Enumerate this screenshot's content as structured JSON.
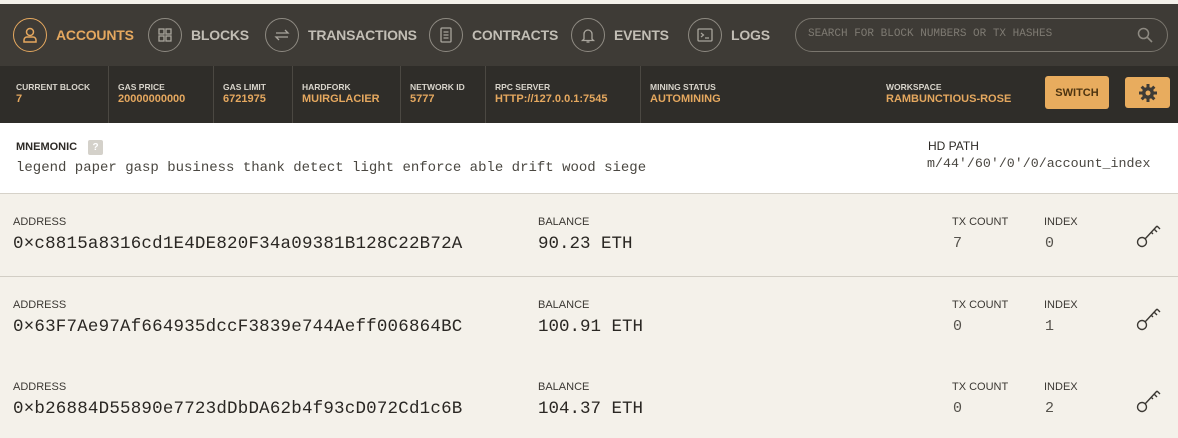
{
  "nav": {
    "items": [
      {
        "label": "ACCOUNTS",
        "icon": "person-icon",
        "active": true
      },
      {
        "label": "BLOCKS",
        "icon": "grid-icon"
      },
      {
        "label": "TRANSACTIONS",
        "icon": "transfer-arrows-icon"
      },
      {
        "label": "CONTRACTS",
        "icon": "document-icon"
      },
      {
        "label": "EVENTS",
        "icon": "bell-icon"
      },
      {
        "label": "LOGS",
        "icon": "terminal-icon"
      }
    ],
    "search_placeholder": "SEARCH FOR BLOCK NUMBERS OR TX HASHES"
  },
  "stats": {
    "current_block": {
      "label": "CURRENT BLOCK",
      "value": "7"
    },
    "gas_price": {
      "label": "GAS PRICE",
      "value": "20000000000"
    },
    "gas_limit": {
      "label": "GAS LIMIT",
      "value": "6721975"
    },
    "hardfork": {
      "label": "HARDFORK",
      "value": "MUIRGLACIER"
    },
    "network_id": {
      "label": "NETWORK ID",
      "value": "5777"
    },
    "rpc_server": {
      "label": "RPC SERVER",
      "value": "HTTP://127.0.0.1:7545"
    },
    "mining_status": {
      "label": "MINING STATUS",
      "value": "AUTOMINING"
    },
    "workspace": {
      "label": "WORKSPACE",
      "value": "RAMBUNCTIOUS-ROSE"
    },
    "switch_label": "SWITCH"
  },
  "mnemonic": {
    "label": "MNEMONIC",
    "help": "?",
    "value": "legend paper gasp business thank detect light enforce able drift wood siege",
    "hd_path_label": "HD PATH",
    "hd_path_value": "m/44'/60'/0'/0/account_index"
  },
  "columns": {
    "address": "ADDRESS",
    "balance": "BALANCE",
    "tx_count": "TX COUNT",
    "index": "INDEX"
  },
  "accounts": [
    {
      "address": "0×c8815a8316cd1E4DE820F34a09381B128C22B72A",
      "balance": "90.23 ETH",
      "tx_count": "7",
      "index": "0"
    },
    {
      "address": "0×63F7Ae97Af664935dccF3839e744Aeff006864BC",
      "balance": "100.91 ETH",
      "tx_count": "0",
      "index": "1"
    },
    {
      "address": "0×b26884D55890e7723dDbDA62b4f93cD072Cd1c6B",
      "balance": "104.37 ETH",
      "tx_count": "0",
      "index": "2"
    }
  ],
  "colors": {
    "accent": "#e5a85f",
    "nav_bg": "#3e3b36",
    "stats_bg": "#2f2d29",
    "page_bg": "#f4f1ea"
  }
}
